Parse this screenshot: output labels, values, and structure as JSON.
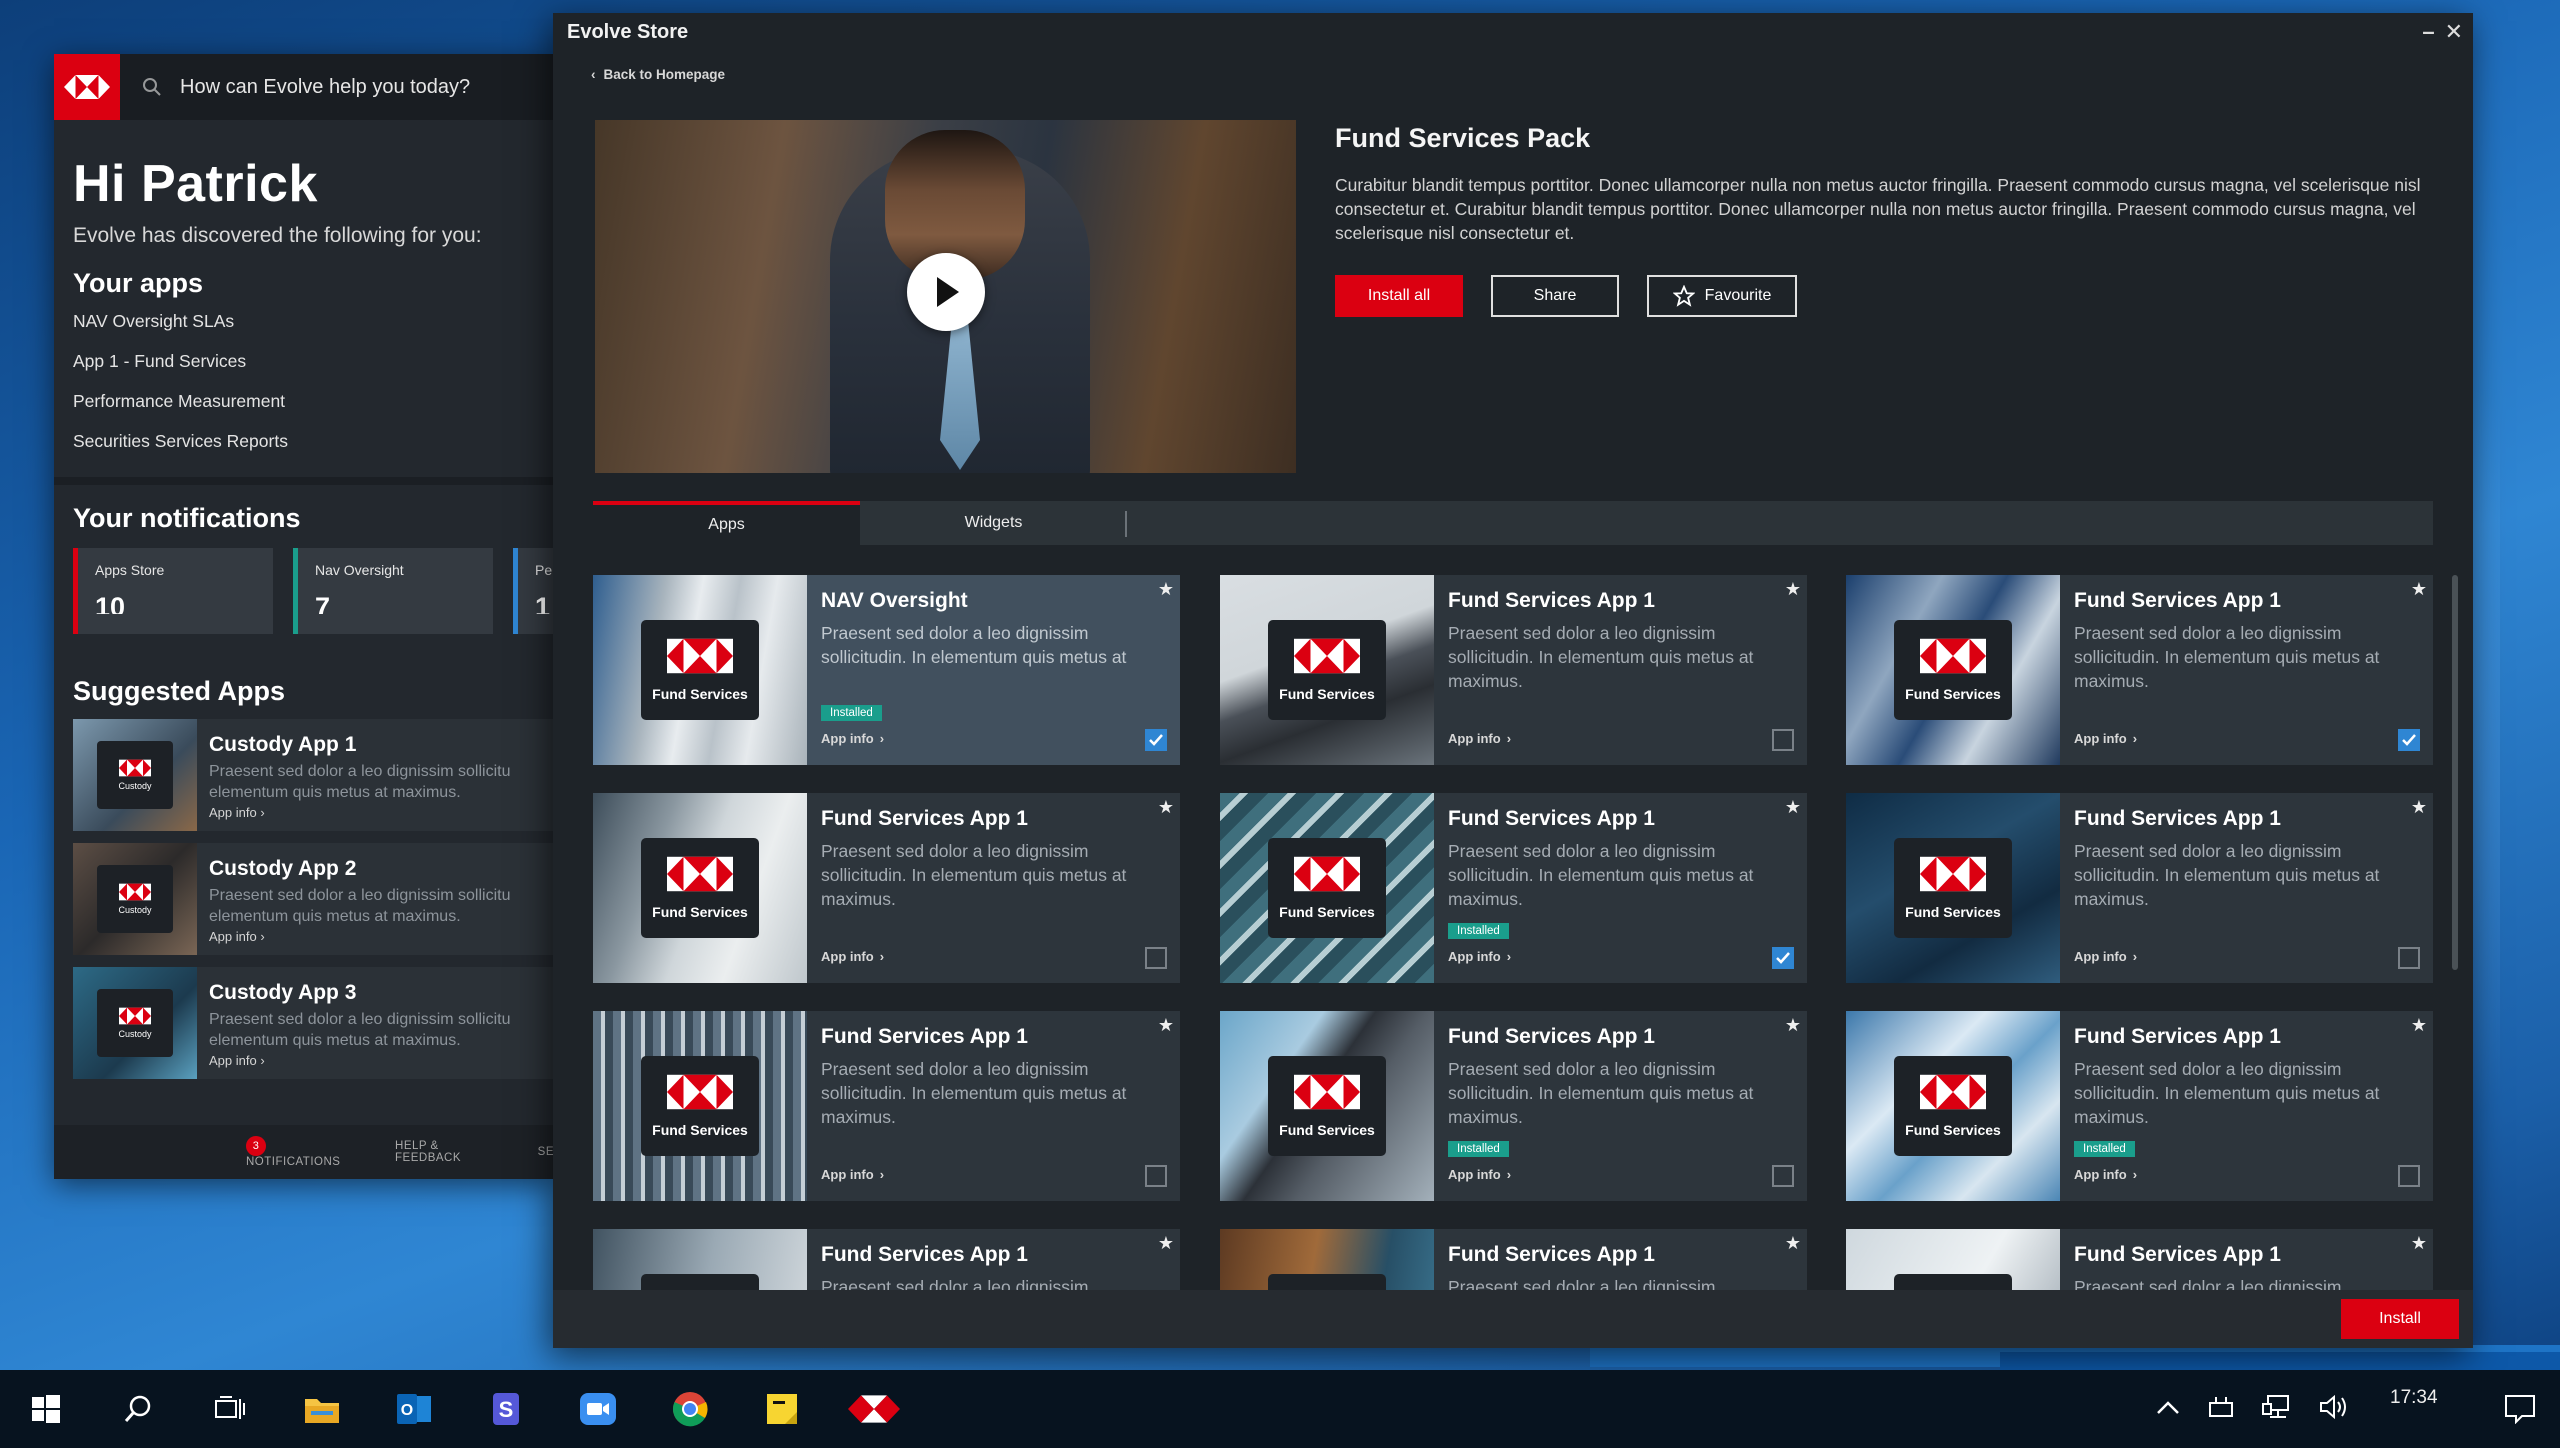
{
  "evolve_panel": {
    "search_placeholder": "How can Evolve help you today?",
    "greeting": "Hi Patrick",
    "discovered": "Evolve has discovered the following for you:",
    "your_apps_heading": "Your apps",
    "your_apps": [
      "NAV Oversight SLAs",
      "App 1 - Fund Services",
      "Performance Measurement",
      "Securities Services Reports"
    ],
    "notifications_heading": "Your notifications",
    "notifications": [
      {
        "label": "Apps Store",
        "value": "10",
        "color": "#db0011"
      },
      {
        "label": "Nav Oversight",
        "value": "7",
        "color": "#1a9e8c"
      },
      {
        "label": "Pe",
        "value": "1",
        "color": "#2f86d3"
      }
    ],
    "suggested_heading": "Suggested Apps",
    "suggested": [
      {
        "title": "Custody App 1",
        "badge": "Custody",
        "desc1": "Praesent sed dolor a leo dignissim sollicitu",
        "desc2": "elementum quis metus at maximus.",
        "link": "App info"
      },
      {
        "title": "Custody App 2",
        "badge": "Custody",
        "desc1": "Praesent sed dolor a leo dignissim sollicitu",
        "desc2": "elementum quis metus at maximus.",
        "link": "App info"
      },
      {
        "title": "Custody App 3",
        "badge": "Custody",
        "desc1": "Praesent sed dolor a leo dignissim sollicitu",
        "desc2": "elementum quis metus at maximus.",
        "link": "App info"
      }
    ],
    "footer": {
      "notif_count": "3",
      "notifications": "NOTIFICATIONS",
      "help": "HELP & FEEDBACK",
      "settings": "SE"
    }
  },
  "store": {
    "window_title": "Evolve Store",
    "back_link": "Back to Homepage",
    "pack_title": "Fund Services Pack",
    "pack_desc": "Curabitur blandit tempus porttitor. Donec ullamcorper nulla non metus auctor fringilla. Praesent commodo cursus magna, vel scelerisque nisl consectetur et. Curabitur blandit tempus porttitor. Donec ullamcorper nulla non metus auctor fringilla. Praesent commodo cursus magna, vel scelerisque nisl consectetur et.",
    "actions": {
      "install_all": "Install all",
      "share": "Share",
      "favourite": "Favourite"
    },
    "tabs": [
      {
        "label": "Apps",
        "active": true
      },
      {
        "label": "Widgets",
        "active": false
      }
    ],
    "badge_label": "Fund Services",
    "installed_label": "Installed",
    "app_info_label": "App info",
    "apps": [
      {
        "title": "NAV Oversight",
        "desc": "Praesent sed dolor a leo dignissim sollicitudin. In elementum quis metus at maximus.",
        "installed": true,
        "checked": true
      },
      {
        "title": "Fund Services App 1",
        "desc": "Praesent sed dolor a leo dignissim sollicitudin. In elementum quis metus at maximus.",
        "installed": false,
        "checked": false
      },
      {
        "title": "Fund Services App 1",
        "desc": "Praesent sed dolor a leo dignissim sollicitudin. In elementum quis metus at maximus.",
        "installed": false,
        "checked": true
      },
      {
        "title": "Fund Services App 1",
        "desc": "Praesent sed dolor a leo dignissim sollicitudin. In elementum quis metus at maximus.",
        "installed": false,
        "checked": false
      },
      {
        "title": "Fund Services App 1",
        "desc": "Praesent sed dolor a leo dignissim sollicitudin. In elementum quis metus at maximus.",
        "installed": true,
        "checked": true
      },
      {
        "title": "Fund Services App 1",
        "desc": "Praesent sed dolor a leo dignissim sollicitudin. In elementum quis metus at maximus.",
        "installed": false,
        "checked": false
      },
      {
        "title": "Fund Services App 1",
        "desc": "Praesent sed dolor a leo dignissim sollicitudin. In elementum quis metus at maximus.",
        "installed": false,
        "checked": false
      },
      {
        "title": "Fund Services App 1",
        "desc": "Praesent sed dolor a leo dignissim sollicitudin. In elementum quis metus at maximus.",
        "installed": true,
        "checked": false
      },
      {
        "title": "Fund Services App 1",
        "desc": "Praesent sed dolor a leo dignissim sollicitudin. In elementum quis metus at maximus.",
        "installed": true,
        "checked": false
      },
      {
        "title": "Fund Services App 1",
        "desc": "Praesent sed dolor a leo dignissim sollicitudin.",
        "installed": false,
        "checked": false
      },
      {
        "title": "Fund Services App 1",
        "desc": "Praesent sed dolor a leo dignissim sollicitudin.",
        "installed": false,
        "checked": false
      },
      {
        "title": "Fund Services App 1",
        "desc": "Praesent sed dolor a leo dignissim sollicitudin.",
        "installed": false,
        "checked": false
      }
    ],
    "install_button": "Install"
  },
  "taskbar": {
    "clock": "17:34",
    "apps": [
      "windows-start",
      "search",
      "task-view",
      "file-explorer",
      "outlook",
      "skype",
      "zoom",
      "chrome",
      "sticky-notes",
      "evolve"
    ]
  },
  "colors": {
    "accent_red": "#db0011",
    "teal": "#1a9e8c",
    "blue": "#2f86d3",
    "panel_bg": "#23282e",
    "card_bg": "#2d353c"
  }
}
